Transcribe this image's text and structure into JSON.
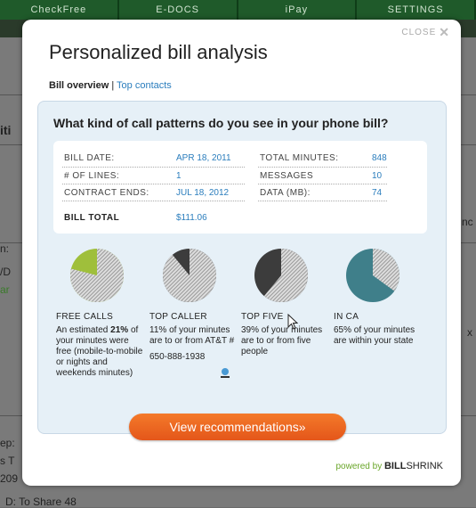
{
  "background": {
    "tabs": [
      "CheckFree",
      "E-DOCS",
      "iPay",
      "SETTINGS"
    ],
    "fragments": [
      "iti",
      "n:",
      "/D",
      "ar",
      "ep:",
      "s T",
      "209",
      "nc",
      "x",
      "D: To Share 48"
    ]
  },
  "modal": {
    "close_label": "CLOSE",
    "close_icon": "close-x-icon",
    "title": "Personalized bill analysis",
    "tab_active": "Bill overview",
    "tab_separator": "|",
    "tab_link": "Top contacts",
    "question": "What kind of call patterns do you see in your phone bill?",
    "bill": {
      "bill_date_label": "BILL DATE:",
      "bill_date": "APR 18, 2011",
      "lines_label": "# OF LINES:",
      "lines": "1",
      "contract_label": "CONTRACT ENDS:",
      "contract": "JUL 18, 2012",
      "total_minutes_label": "TOTAL MINUTES:",
      "total_minutes": "848",
      "messages_label": "MESSAGES",
      "messages": "10",
      "data_label": "DATA (MB):",
      "data": "74",
      "total_label": "BILL TOTAL",
      "total": "$111.06"
    },
    "stats": [
      {
        "title": "FREE CALLS",
        "text_pre": "An estimated",
        "highlight": "21%",
        "text_post": "of your minutes were free (mobile-to-mobile or nights and weekends minutes)",
        "fraction": 0.21,
        "color": "#9fbf3b"
      },
      {
        "title": "TOP CALLER",
        "highlight": "11%",
        "text_post": "of your minutes are to or from AT&T #",
        "number": "650-888-1938",
        "fraction": 0.11,
        "color": "#3c3c3c"
      },
      {
        "title": "TOP FIVE",
        "highlight": "39%",
        "text_post": "of your minutes are to or from five people",
        "fraction": 0.39,
        "color": "#3c3c3c"
      },
      {
        "title": "IN CA",
        "highlight": "65%",
        "text_post": "of your minutes are within your state",
        "fraction": 0.65,
        "color": "#3f7f8a"
      }
    ],
    "button_label": "View recommendations»",
    "powered_by": "powered by",
    "brand_bold": "BILL",
    "brand_rest": "SHRINK"
  }
}
